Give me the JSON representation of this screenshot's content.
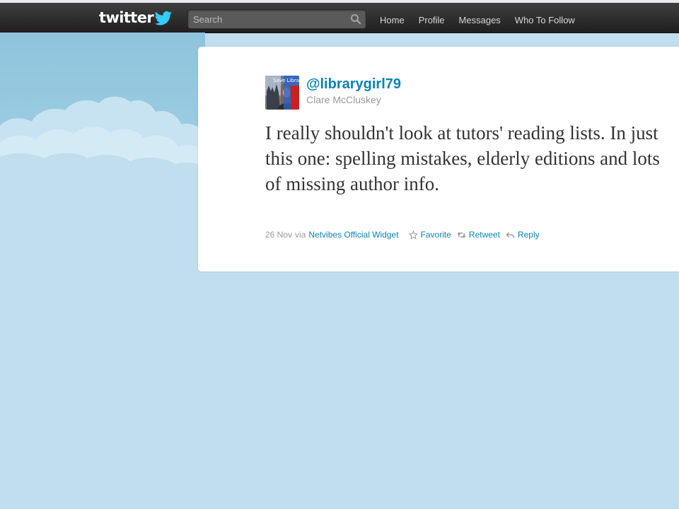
{
  "topbar": {
    "logo_text": "twitter",
    "search": {
      "placeholder": "Search"
    },
    "nav": [
      {
        "label": "Home"
      },
      {
        "label": "Profile"
      },
      {
        "label": "Messages"
      },
      {
        "label": "Who To Follow"
      }
    ]
  },
  "tweet": {
    "handle": "@librarygirl79",
    "full_name": "Clare McCluskey",
    "avatar_overlay": "Save Libraries",
    "text": "I really shouldn't look at tutors' reading lists. In just this one: spelling mistakes, elderly editions and lots of missing author info.",
    "date": "26 Nov",
    "via_label": "via",
    "source": "Netvibes Official Widget",
    "actions": {
      "favorite": "Favorite",
      "retweet": "Retweet",
      "reply": "Reply"
    }
  },
  "colors": {
    "background": "#c0deed",
    "link": "#0a84b3",
    "topbar": "#2b2b2b"
  },
  "icons": [
    "twitter-bird-icon",
    "search-icon",
    "star-icon",
    "retweet-icon",
    "reply-icon"
  ]
}
